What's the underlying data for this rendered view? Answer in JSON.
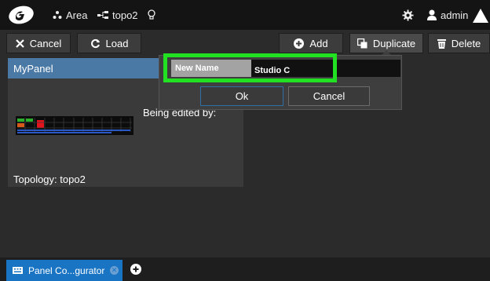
{
  "topbar": {
    "area_label": "Area",
    "topology_label": "topo2",
    "user_label": "admin"
  },
  "toolbar": {
    "cancel_label": "Cancel",
    "load_label": "Load",
    "add_label": "Add",
    "duplicate_label": "Duplicate",
    "delete_label": "Delete"
  },
  "panel": {
    "title": "MyPanel",
    "editing_text": "Being edited by:",
    "topology_text": "Topology: topo2"
  },
  "duplicate_dialog": {
    "name_label": "New Name",
    "name_value": "Studio C",
    "ok_label": "Ok",
    "cancel_label": "Cancel"
  },
  "tabs": [
    {
      "label": "Panel Co...gurator"
    }
  ],
  "colors": {
    "accent_blue": "#1a74c4",
    "selection_blue": "#4b79a6",
    "highlight_green": "#22e022"
  }
}
